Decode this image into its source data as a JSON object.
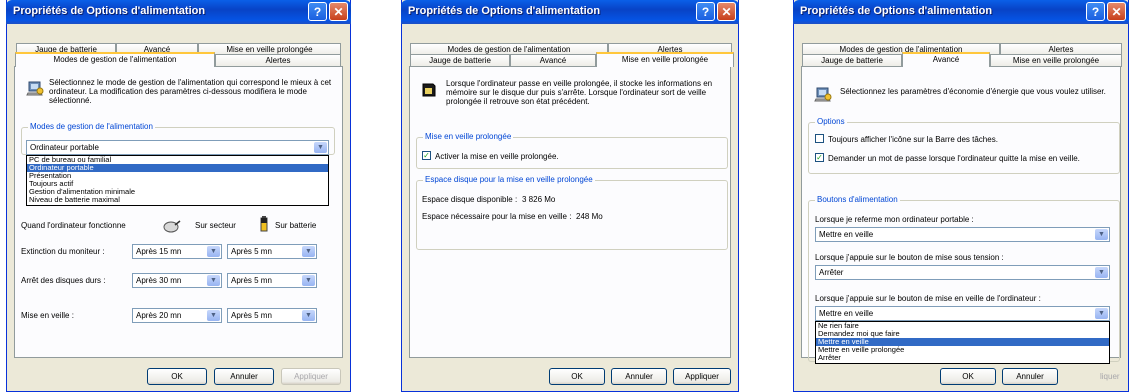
{
  "window_title": "Propriétés de Options d'alimentation",
  "buttons": {
    "ok": "OK",
    "cancel": "Annuler",
    "apply": "Appliquer"
  },
  "title_buttons": {
    "help": "?",
    "close": "✕"
  },
  "w1": {
    "tabs_back": [
      "Jauge de batterie",
      "Avancé",
      "Mise en veille prolongée"
    ],
    "tabs_front": [
      "Modes de gestion de l'alimentation",
      "Alertes"
    ],
    "intro": "Sélectionnez le mode de gestion de l'alimentation qui correspond le mieux à cet ordinateur. La modification des paramètres ci-dessous modifiera le mode sélectionné.",
    "group_label": "Modes de gestion de l'alimentation",
    "scheme_value": "Ordinateur portable",
    "scheme_options": [
      "PC de bureau ou familial",
      "Ordinateur portable",
      "Présentation",
      "Toujours actif",
      "Gestion d'alimentation minimale",
      "Niveau de batterie maximal"
    ],
    "scheme_selected_index": 1,
    "when_label": "Quand l'ordinateur fonctionne",
    "col_ac": "Sur secteur",
    "col_battery": "Sur batterie",
    "rows": [
      {
        "label": "Extinction du moniteur :",
        "ac": "Après 15 mn",
        "battery": "Après 5 mn"
      },
      {
        "label": "Arrêt des disques durs :",
        "ac": "Après 30 mn",
        "battery": "Après 5 mn"
      },
      {
        "label": "Mise en veille :",
        "ac": "Après 20 mn",
        "battery": "Après 5 mn"
      }
    ]
  },
  "w2": {
    "tabs_back": [
      "Modes de gestion de l'alimentation",
      "Alertes"
    ],
    "tabs_front": [
      "Jauge de batterie",
      "Avancé",
      "Mise en veille prolongée"
    ],
    "intro": "Lorsque l'ordinateur passe en veille prolongée, il stocke les informations en mémoire sur le disque dur puis s'arrête. Lorsque l'ordinateur sort de veille prolongée il retrouve son état précédent.",
    "group1_label": "Mise en veille prolongée",
    "checkbox_label": "Activer la mise en veille prolongée.",
    "group2_label": "Espace disque pour la mise en veille prolongée",
    "free_label": "Espace disque disponible :",
    "free_value": "3 826 Mo",
    "needed_label": "Espace nécessaire pour la mise en veille :",
    "needed_value": "248 Mo"
  },
  "w3": {
    "tabs_back": [
      "Modes de gestion de l'alimentation",
      "Alertes"
    ],
    "tabs_front": [
      "Jauge de batterie",
      "Avancé",
      "Mise en veille prolongée"
    ],
    "intro": "Sélectionnez les paramètres d'économie d'énergie que vous voulez utiliser.",
    "options_label": "Options",
    "opt1": "Toujours afficher l'icône sur la Barre des tâches.",
    "opt2": "Demander un mot de passe lorsque l'ordinateur quitte la mise en veille.",
    "power_label": "Boutons d'alimentation",
    "q1": "Lorsque je referme mon ordinateur portable :",
    "a1": "Mettre en veille",
    "q2": "Lorsque j'appuie sur le bouton de mise sous tension :",
    "a2": "Arrêter",
    "q3": "Lorsque j'appuie sur le bouton de mise en veille de l'ordinateur :",
    "a3": "Mettre en veille",
    "a3_options": [
      "Ne rien faire",
      "Demandez moi que faire",
      "Mettre en veille",
      "Mettre en veille prolongée",
      "Arrêter"
    ],
    "a3_selected_index": 2,
    "partial_apply": "liquer"
  }
}
